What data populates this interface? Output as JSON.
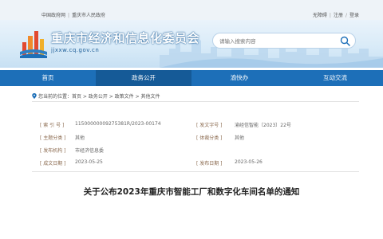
{
  "topbar": {
    "gov_link": "中国政府网",
    "cq_link": "重庆市人民政府",
    "accessibility": "无障碍",
    "register": "注册",
    "login": "登录"
  },
  "header": {
    "site_title": "重庆市经济和信息化委员会",
    "domain": "jjxxw.cq.gov.cn",
    "search_placeholder": "请输入搜索内容"
  },
  "nav": {
    "items": [
      {
        "label": "首页"
      },
      {
        "label": "政务公开"
      },
      {
        "label": "渝快办"
      },
      {
        "label": "互动交流"
      }
    ]
  },
  "breadcrumb": {
    "text": "您当前的位置：首页 > 政务公开 > 政策文件 > 其他文件"
  },
  "meta": {
    "rows": [
      {
        "label1": "[ 索 引 号 ]",
        "value1": "11500000009275381R/2023-00174",
        "label2": "[ 发文字号 ]",
        "value2": "渝经信智能〔2023〕22号"
      },
      {
        "label1": "[ 主题分类 ]",
        "value1": "其他",
        "label2": "[ 体裁分类 ]",
        "value2": "其他"
      },
      {
        "label1": "[ 发布机构 ]",
        "value1": "市经济信息委",
        "label2": "",
        "value2": ""
      },
      {
        "label1": "[ 成文日期 ]",
        "value1": "2023-05-25",
        "label2": "[ 发布日期 ]",
        "value2": "2023-05-26"
      }
    ]
  },
  "document": {
    "title": "关于公布2023年重庆市智能工厂和数字化车间名单的通知"
  },
  "colors": {
    "nav_bg": "#1d6fb8",
    "label_brown": "#8b6a4f"
  }
}
